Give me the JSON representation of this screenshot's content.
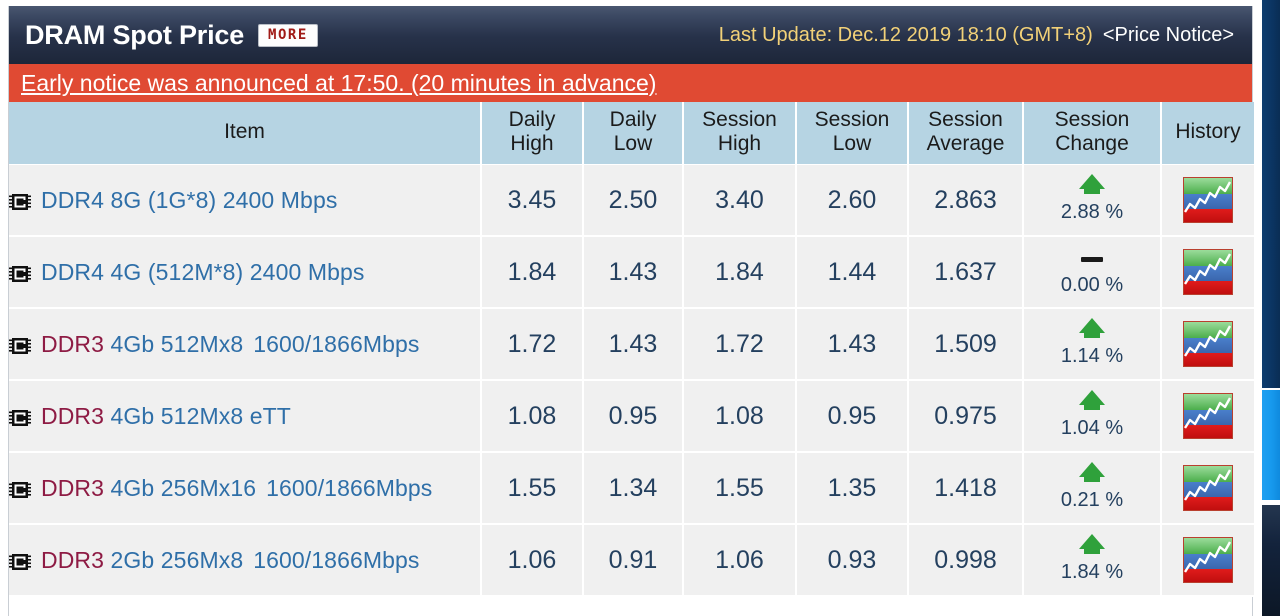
{
  "header": {
    "title": "DRAM Spot Price",
    "more_label": "MORE",
    "last_update": "Last Update: Dec.12 2019 18:10 (GMT+8)",
    "price_notice": "<Price Notice>"
  },
  "notice": {
    "text": "Early notice was announced at 17:50. (20 minutes in advance)"
  },
  "table": {
    "columns": [
      "Item",
      "Daily\nHigh",
      "Daily\nLow",
      "Session\nHigh",
      "Session\nLow",
      "Session\nAverage",
      "Session\nChange",
      "History"
    ],
    "columns_display": {
      "item": "Item",
      "daily_high_1": "Daily",
      "daily_high_2": "High",
      "daily_low_1": "Daily",
      "daily_low_2": "Low",
      "session_high_1": "Session",
      "session_high_2": "High",
      "session_low_1": "Session",
      "session_low_2": "Low",
      "session_avg_1": "Session",
      "session_avg_2": "Average",
      "session_chg_1": "Session",
      "session_chg_2": "Change",
      "history": "History"
    },
    "rows": [
      {
        "item_type": "DDR4",
        "item_rest": "8G (1G*8) 2400 Mbps",
        "item_line2": "",
        "daily_high": "3.45",
        "daily_low": "2.50",
        "session_high": "3.40",
        "session_low": "2.60",
        "session_average": "2.863",
        "session_change": "2.88 %",
        "direction": "up"
      },
      {
        "item_type": "DDR4",
        "item_rest": "4G (512M*8) 2400 Mbps",
        "item_line2": "",
        "daily_high": "1.84",
        "daily_low": "1.43",
        "session_high": "1.84",
        "session_low": "1.44",
        "session_average": "1.637",
        "session_change": "0.00 %",
        "direction": "flat"
      },
      {
        "item_type": "DDR3",
        "item_rest": "4Gb 512Mx8",
        "item_line2": "1600/1866Mbps",
        "daily_high": "1.72",
        "daily_low": "1.43",
        "session_high": "1.72",
        "session_low": "1.43",
        "session_average": "1.509",
        "session_change": "1.14 %",
        "direction": "up"
      },
      {
        "item_type": "DDR3",
        "item_rest": "4Gb 512Mx8 eTT",
        "item_line2": "",
        "daily_high": "1.08",
        "daily_low": "0.95",
        "session_high": "1.08",
        "session_low": "0.95",
        "session_average": "0.975",
        "session_change": "1.04 %",
        "direction": "up"
      },
      {
        "item_type": "DDR3",
        "item_rest": "4Gb 256Mx16",
        "item_line2": "1600/1866Mbps",
        "daily_high": "1.55",
        "daily_low": "1.34",
        "session_high": "1.55",
        "session_low": "1.35",
        "session_average": "1.418",
        "session_change": "0.21 %",
        "direction": "up"
      },
      {
        "item_type": "DDR3",
        "item_rest": "2Gb 256Mx8",
        "item_line2": "1600/1866Mbps",
        "daily_high": "1.06",
        "daily_low": "0.91",
        "session_high": "1.06",
        "session_low": "0.93",
        "session_average": "0.998",
        "session_change": "1.84 %",
        "direction": "up"
      }
    ]
  },
  "icons": {
    "chip": "memory-chip-icon",
    "history": "history-chart-icon",
    "arrow_up": "arrow-up-icon",
    "flat": "flat-dash-icon"
  },
  "colors": {
    "title_bar": "#27324a",
    "notice_bg": "#e04a33",
    "header_bg": "#b6d4e3",
    "row_bg": "#f0f0f0",
    "link_blue": "#2f6fa8",
    "ddr3_red": "#8e1b44",
    "up_green": "#2fa13b",
    "update_gold": "#f2d178"
  }
}
